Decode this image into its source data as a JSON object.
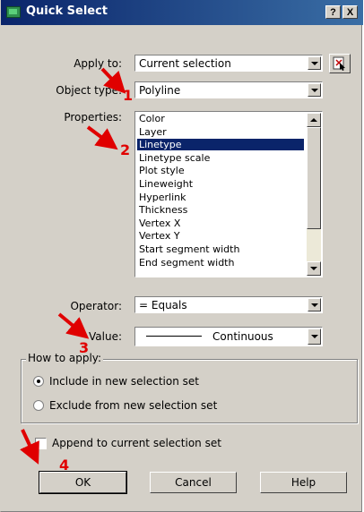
{
  "dialog": {
    "title": "Quick Select",
    "help_btn": "?",
    "close_btn": "X"
  },
  "fields": {
    "apply_to_label": "Apply to:",
    "apply_to_value": "Current selection",
    "object_type_label": "Object type:",
    "object_type_value": "Polyline",
    "properties_label": "Properties:",
    "operator_label": "Operator:",
    "operator_value": "= Equals",
    "value_label": "Value:",
    "value_value": "Continuous"
  },
  "properties_list": [
    "Color",
    "Layer",
    "Linetype",
    "Linetype scale",
    "Plot style",
    "Lineweight",
    "Hyperlink",
    "Thickness",
    "Vertex X",
    "Vertex Y",
    "Start segment width",
    "End segment width"
  ],
  "properties_selected": "Linetype",
  "how_to_apply": {
    "title": "How to apply:",
    "option_include": "Include in new selection set",
    "option_exclude": "Exclude from new selection set",
    "selected": "include"
  },
  "append": {
    "label": "Append to current selection set",
    "checked": false
  },
  "buttons": {
    "ok": "OK",
    "cancel": "Cancel",
    "help": "Help"
  },
  "annotations": {
    "step1": "1",
    "step2": "2",
    "step3": "3",
    "step4": "4",
    "color": "#e00000"
  },
  "colors": {
    "title_bar": "#0a246a",
    "selection": "#0a246a",
    "dialog_bg": "#d4d0c8"
  },
  "icons": {
    "title": "autocad-app-icon",
    "select_objects": "select-objects-icon"
  }
}
